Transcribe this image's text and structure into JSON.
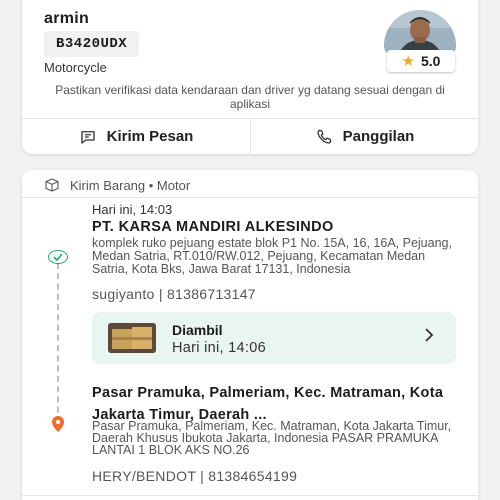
{
  "driver": {
    "name": "armin",
    "plate": "B3420UDX",
    "vehicle_type": "Motorcycle",
    "rating": "5.0",
    "notice": "Pastikan verifikasi data kendaraan dan driver yg datang sesuai dengan di aplikasi",
    "actions": {
      "message_label": "Kirim Pesan",
      "call_label": "Panggilan"
    }
  },
  "order": {
    "header": "Kirim Barang • Motor",
    "pickup": {
      "time": "Hari ini, 14:03",
      "title": "PT. KARSA MANDIRI ALKESINDO",
      "address": "komplek ruko pejuang estate blok P1 No. 15A, 16, 16A, Pejuang, Medan Satria, RT.010/RW.012, Pejuang, Kecamatan Medan Satria, Kota Bks, Jawa Barat 17131, Indonesia",
      "contact": "sugiyanto | 81386713147"
    },
    "status": {
      "title": "Diambil",
      "time": "Hari ini, 14:06"
    },
    "destination": {
      "title": "Pasar Pramuka, Palmeriam, Kec. Matraman, Kota Jakarta Timur, Daerah ...",
      "address": "Pasar Pramuka, Palmeriam, Kec. Matraman, Kota Jakarta Timur, Daerah Khusus Ibukota Jakarta, Indonesia PASAR PRAMUKA LANTAI 1 BLOK AKS NO.26",
      "contact": "HERY/BENDOT | 81384654199"
    }
  },
  "colors": {
    "accent_green": "#2aa872",
    "status_bg": "#e8f5f0",
    "star": "#f4a724",
    "destination_pin": "#f26b2a"
  },
  "icons": {
    "message": "chat-icon",
    "call": "phone-icon",
    "package": "package-icon",
    "pickup": "check-circle-icon",
    "destination": "location-pin-icon",
    "chevron": "chevron-right-icon",
    "star": "star-icon"
  }
}
